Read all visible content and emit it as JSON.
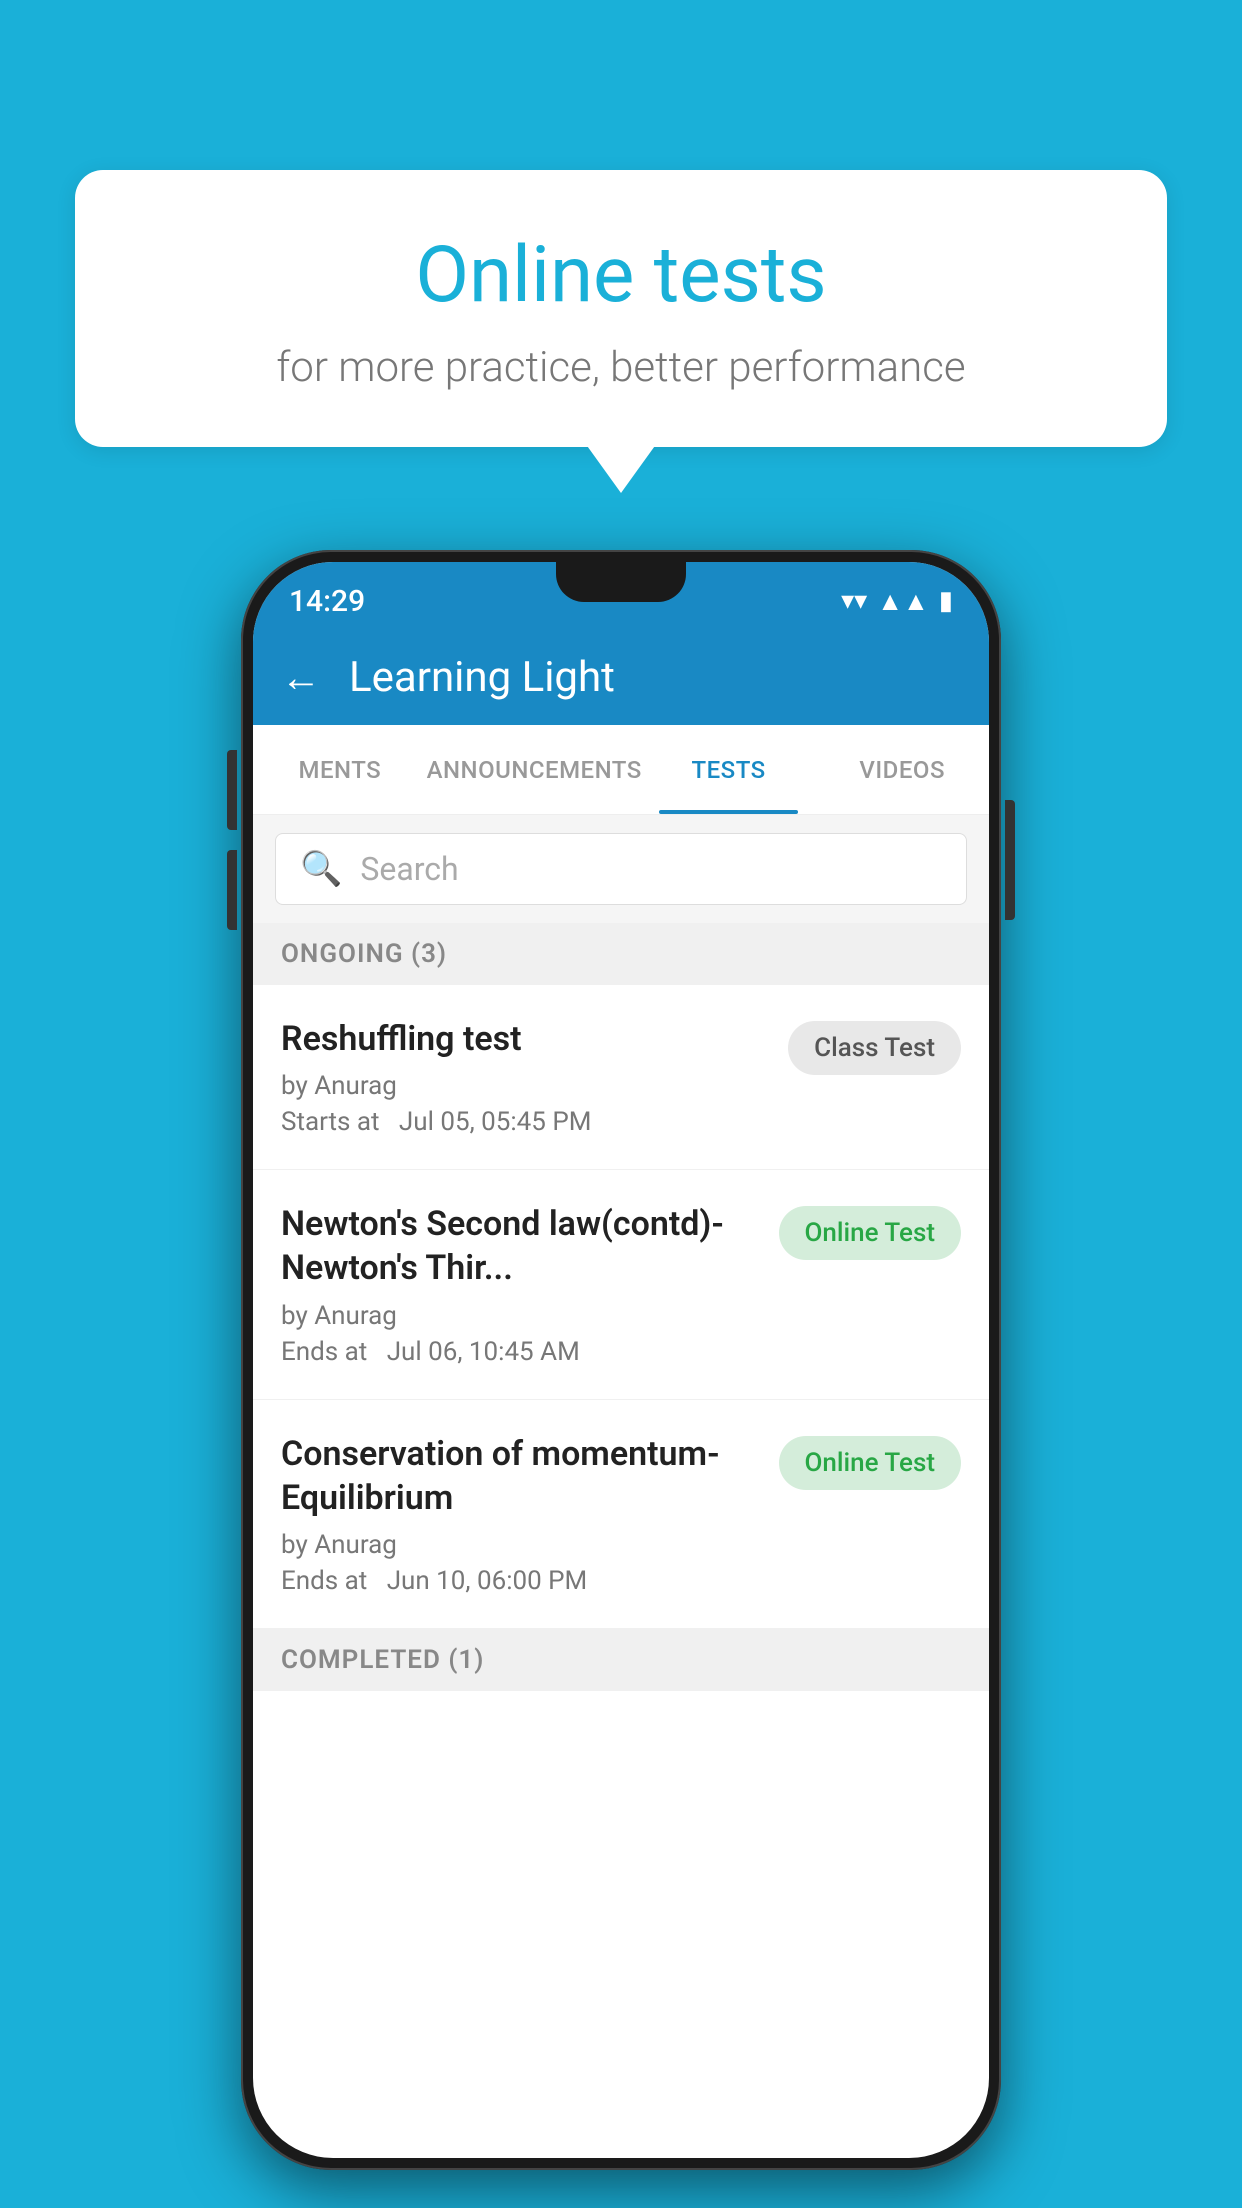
{
  "background_color": "#1ab0d8",
  "speech_bubble": {
    "title": "Online tests",
    "subtitle": "for more practice, better performance"
  },
  "phone": {
    "status_bar": {
      "time": "14:29",
      "icons": [
        "wifi",
        "signal",
        "battery"
      ]
    },
    "header": {
      "back_label": "←",
      "title": "Learning Light"
    },
    "tabs": [
      {
        "label": "MENTS",
        "active": false
      },
      {
        "label": "ANNOUNCEMENTS",
        "active": false
      },
      {
        "label": "TESTS",
        "active": true
      },
      {
        "label": "VIDEOS",
        "active": false
      }
    ],
    "search": {
      "placeholder": "Search"
    },
    "ongoing_section": {
      "header": "ONGOING (3)",
      "items": [
        {
          "name": "Reshuffling test",
          "author": "by Anurag",
          "date_label": "Starts at",
          "date_value": "Jul 05, 05:45 PM",
          "badge": "Class Test",
          "badge_type": "class"
        },
        {
          "name": "Newton's Second law(contd)-Newton's Thir...",
          "author": "by Anurag",
          "date_label": "Ends at",
          "date_value": "Jul 06, 10:45 AM",
          "badge": "Online Test",
          "badge_type": "online"
        },
        {
          "name": "Conservation of momentum-Equilibrium",
          "author": "by Anurag",
          "date_label": "Ends at",
          "date_value": "Jun 10, 06:00 PM",
          "badge": "Online Test",
          "badge_type": "online"
        }
      ]
    },
    "completed_section": {
      "header": "COMPLETED (1)"
    }
  }
}
